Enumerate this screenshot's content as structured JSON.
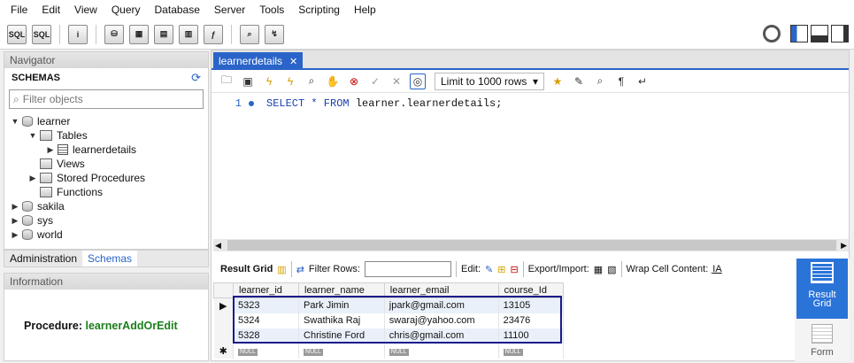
{
  "menu": [
    "File",
    "Edit",
    "View",
    "Query",
    "Database",
    "Server",
    "Tools",
    "Scripting",
    "Help"
  ],
  "toolbar": {
    "icons": [
      "new-sql-tab-icon",
      "open-sql-icon",
      "inspector-icon",
      "create-schema-icon",
      "create-table-icon",
      "create-view-icon",
      "create-procedure-icon",
      "create-function-icon",
      "search-table-icon",
      "reconnect-icon"
    ]
  },
  "navigator": {
    "header": "Navigator",
    "schemas_title": "SCHEMAS",
    "filter_placeholder": "Filter objects",
    "tree": [
      {
        "label": "learner",
        "level": 0,
        "arrow": "▼",
        "icon": "db"
      },
      {
        "label": "Tables",
        "level": 1,
        "arrow": "▼",
        "icon": "folder"
      },
      {
        "label": "learnerdetails",
        "level": 2,
        "arrow": "▶",
        "icon": "table"
      },
      {
        "label": "Views",
        "level": 1,
        "arrow": "",
        "icon": "folder"
      },
      {
        "label": "Stored Procedures",
        "level": 1,
        "arrow": "▶",
        "icon": "folder"
      },
      {
        "label": "Functions",
        "level": 1,
        "arrow": "",
        "icon": "folder"
      },
      {
        "label": "sakila",
        "level": 0,
        "arrow": "▶",
        "icon": "db"
      },
      {
        "label": "sys",
        "level": 0,
        "arrow": "▶",
        "icon": "db"
      },
      {
        "label": "world",
        "level": 0,
        "arrow": "▶",
        "icon": "db"
      }
    ]
  },
  "nav_tabs": {
    "administration": "Administration",
    "schemas": "Schemas"
  },
  "information": {
    "header": "Information",
    "label": "Procedure:",
    "name": "learnerAddOrEdit"
  },
  "editor": {
    "tab_label": "learnerdetails",
    "limit": "Limit to 1000 rows",
    "line_number": "1",
    "code_keywords": "SELECT * FROM",
    "code_rest": " learner.learnerdetails;"
  },
  "results": {
    "result_grid": "Result Grid",
    "filter_rows": "Filter Rows:",
    "edit": "Edit:",
    "export_import": "Export/Import:",
    "wrap": "Wrap Cell Content:",
    "columns": [
      "learner_id",
      "learner_name",
      "learner_email",
      "course_Id"
    ],
    "rows": [
      [
        "5323",
        "Park Jimin",
        "jpark@gmail.com",
        "13105"
      ],
      [
        "5324",
        "Swathika Raj",
        "swaraj@yahoo.com",
        "23476"
      ],
      [
        "5328",
        "Christine Ford",
        "chris@gmail.com",
        "11100"
      ]
    ],
    "null_label": "NULL"
  },
  "side_panel": {
    "result_grid": "Result\nGrid",
    "form": "Form"
  },
  "colors": {
    "accent": "#2a64c8",
    "procedure_name": "#1a7f1a",
    "highlight_border": "#1a1a8c"
  }
}
